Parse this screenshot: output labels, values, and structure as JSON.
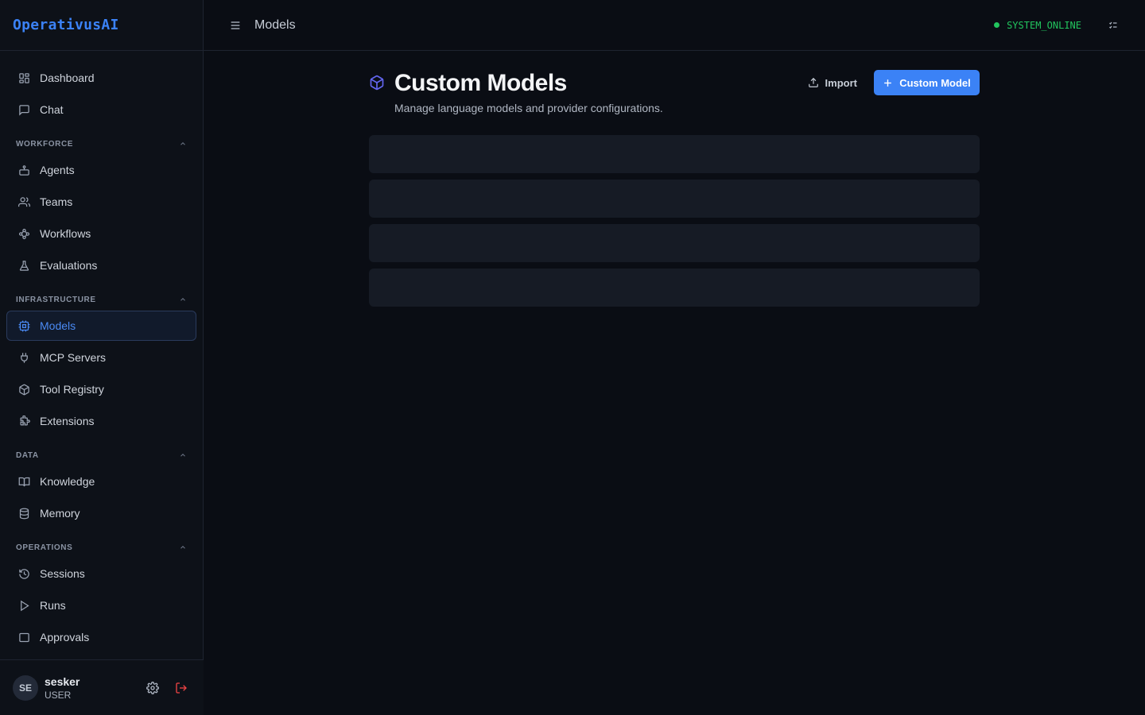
{
  "brand": "OperativusAI",
  "nav": {
    "top": [
      {
        "label": "Dashboard",
        "icon": "dashboard-icon"
      },
      {
        "label": "Chat",
        "icon": "chat-icon"
      }
    ],
    "sections": [
      {
        "title": "WORKFORCE",
        "items": [
          {
            "label": "Agents",
            "icon": "bot-icon"
          },
          {
            "label": "Teams",
            "icon": "users-icon"
          },
          {
            "label": "Workflows",
            "icon": "workflow-icon"
          },
          {
            "label": "Evaluations",
            "icon": "flask-icon"
          }
        ]
      },
      {
        "title": "INFRASTRUCTURE",
        "items": [
          {
            "label": "Models",
            "icon": "cpu-icon",
            "active": true
          },
          {
            "label": "MCP Servers",
            "icon": "plug-icon"
          },
          {
            "label": "Tool Registry",
            "icon": "package-icon"
          },
          {
            "label": "Extensions",
            "icon": "puzzle-icon"
          }
        ]
      },
      {
        "title": "DATA",
        "items": [
          {
            "label": "Knowledge",
            "icon": "book-icon"
          },
          {
            "label": "Memory",
            "icon": "database-icon"
          }
        ]
      },
      {
        "title": "OPERATIONS",
        "items": [
          {
            "label": "Sessions",
            "icon": "history-icon"
          },
          {
            "label": "Runs",
            "icon": "play-icon"
          },
          {
            "label": "Approvals",
            "icon": "inbox-icon"
          }
        ]
      }
    ]
  },
  "user": {
    "initials": "SE",
    "name": "sesker",
    "role": "USER"
  },
  "topbar": {
    "breadcrumb": "Models",
    "status": "SYSTEM_ONLINE"
  },
  "page": {
    "title": "Custom Models",
    "subtitle": "Manage language models and provider configurations.",
    "import_label": "Import",
    "add_label": "Custom Model"
  },
  "colors": {
    "accent": "#3b82f6",
    "status_online": "#22c55e",
    "title_icon": "#6366f1"
  }
}
